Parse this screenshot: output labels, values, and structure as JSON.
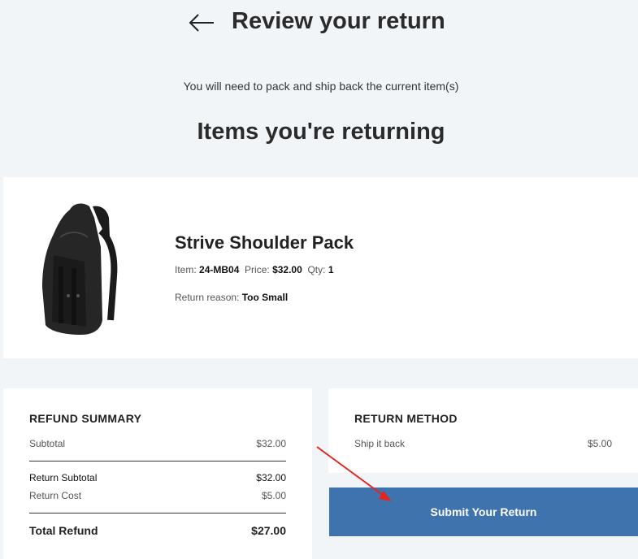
{
  "header": {
    "back_icon": "arrow-left-icon",
    "title": "Review your return"
  },
  "subtitle": "You will need to pack and ship back the current item(s)",
  "section_title": "Items you're returning",
  "item": {
    "name": "Strive Shoulder Pack",
    "item_label": "Item:",
    "sku": "24-MB04",
    "price_label": "Price:",
    "price": "$32.00",
    "qty_label": "Qty:",
    "qty": "1",
    "reason_label": "Return reason:",
    "reason": "Too Small",
    "image_icon": "backpack-image"
  },
  "refund_summary": {
    "heading": "REFUND SUMMARY",
    "subtotal_label": "Subtotal",
    "subtotal_value": "$32.00",
    "return_subtotal_label": "Return Subtotal",
    "return_subtotal_value": "$32.00",
    "return_cost_label": "Return Cost",
    "return_cost_value": "$5.00",
    "total_label": "Total Refund",
    "total_value": "$27.00"
  },
  "return_method": {
    "heading": "RETURN METHOD",
    "method_label": "Ship it back",
    "method_value": "$5.00"
  },
  "submit": {
    "label": "Submit Your Return",
    "color": "#3e73ae"
  },
  "colors": {
    "background": "#f2f5f8",
    "card": "#ffffff",
    "annotation": "#e52420"
  }
}
